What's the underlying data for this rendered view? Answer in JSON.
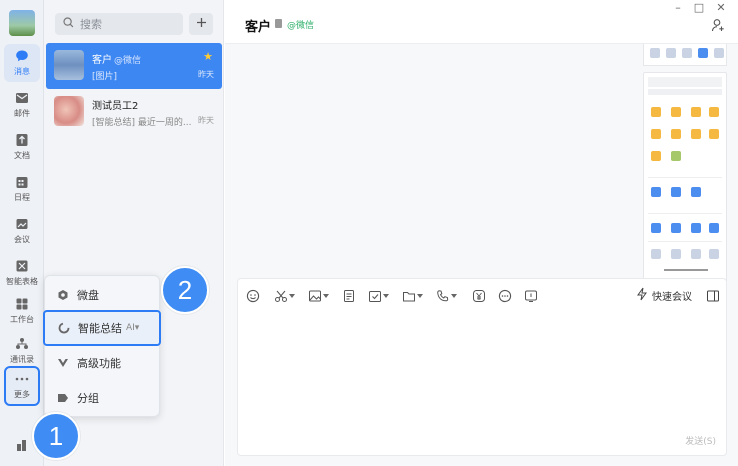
{
  "rail": {
    "items": [
      {
        "label": "消息",
        "icon": "message-icon"
      },
      {
        "label": "邮件",
        "icon": "mail-icon"
      },
      {
        "label": "文档",
        "icon": "document-icon"
      },
      {
        "label": "日程",
        "icon": "calendar-icon"
      },
      {
        "label": "会议",
        "icon": "meeting-icon"
      },
      {
        "label": "智能表格",
        "icon": "smart-sheet-icon"
      },
      {
        "label": "工作台",
        "icon": "workbench-icon"
      },
      {
        "label": "通讯录",
        "icon": "contacts-icon"
      },
      {
        "label": "更多",
        "icon": "more-icon"
      }
    ]
  },
  "search": {
    "placeholder": "搜索"
  },
  "conversations": [
    {
      "name": "客户",
      "sub": "@微信",
      "preview": "[图片]",
      "time": "昨天",
      "starred": true
    },
    {
      "name": "测试员工2",
      "preview": "[智能总结] 最近一周的...",
      "time": "昨天"
    }
  ],
  "popup_menu": {
    "items": [
      {
        "label": "微盘",
        "icon": "weipan-icon"
      },
      {
        "label": "智能总结",
        "ai": "AI▾",
        "icon": "summary-icon"
      },
      {
        "label": "高级功能",
        "icon": "advanced-icon"
      },
      {
        "label": "分组",
        "icon": "tag-icon"
      }
    ]
  },
  "badges": {
    "step1": "1",
    "step2": "2"
  },
  "chat": {
    "title": "客户",
    "wechat_tag": "@微信",
    "quick_meeting": "快速会议",
    "send": "发送(S)"
  },
  "colors": {
    "accent": "#3d87f2",
    "badge": "#3e8cf4",
    "wechat": "#2aae67"
  }
}
